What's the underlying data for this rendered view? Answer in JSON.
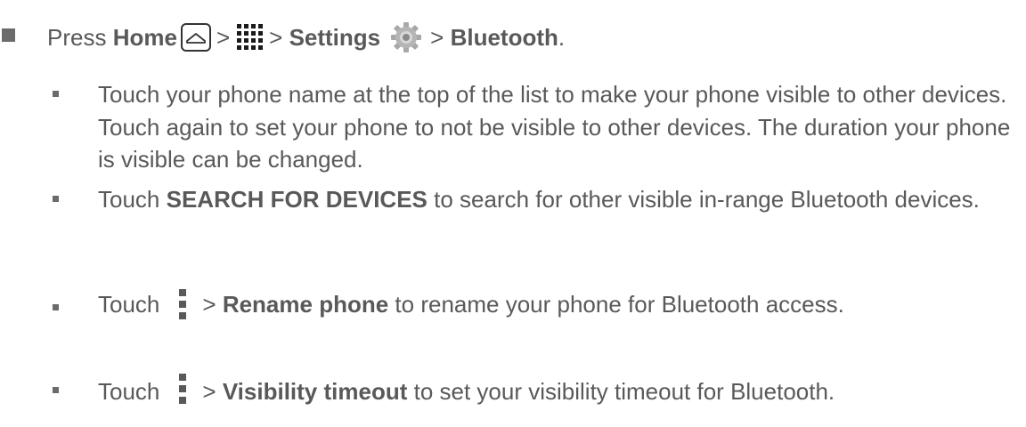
{
  "main_step": {
    "press": "Press",
    "home": "Home",
    "gt1": ">",
    "gt2": ">",
    "settings": "Settings",
    "gt3": ">",
    "bluetooth": "Bluetooth",
    "period": "."
  },
  "items": [
    {
      "text": "Touch your phone name at the top of the list to make your phone visible to other devices. Touch again to set your phone to not be visible to other devices. The duration your phone is visible can be changed."
    },
    {
      "touch": "Touch",
      "bold": "SEARCH FOR DEVICES",
      "rest": "to search for other visible in-range Bluetooth devices."
    },
    {
      "touch": "Touch",
      "gt": ">",
      "bold": "Rename phone",
      "rest": "to rename your phone for Bluetooth access."
    },
    {
      "touch": "Touch",
      "gt": ">",
      "bold": "Visibility timeout",
      "rest": "to set your visibility timeout for Bluetooth."
    }
  ],
  "icons": {
    "home": "home-icon",
    "apps": "apps-grid-icon",
    "settings": "gear-icon",
    "menu": "menu-overflow-icon"
  }
}
